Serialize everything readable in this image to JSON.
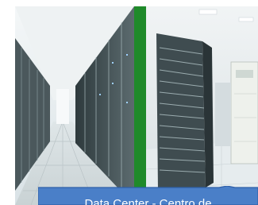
{
  "photo": {
    "alt": "",
    "colors": {
      "divider": "#1f8a2a",
      "caption_fill": "#4a7fc8",
      "caption_border": "#2f5fa8",
      "caption_text": "#ffffff"
    }
  },
  "caption": {
    "text": "Data Center - Centro de"
  }
}
